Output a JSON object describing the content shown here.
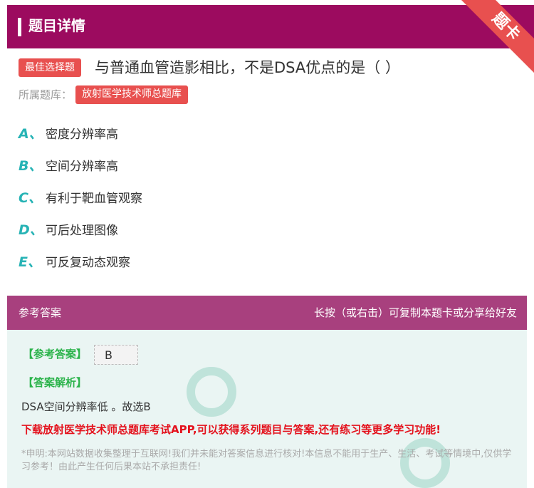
{
  "header": {
    "title": "题目详情",
    "corner_badge": "题卡"
  },
  "question": {
    "type_tag": "最佳选择题",
    "text": "与普通血管造影相比，不是DSA优点的是（ ）",
    "library_label": "所属题库：",
    "library_name": "放射医学技术师总题库"
  },
  "options": [
    {
      "letter": "A、",
      "text": "密度分辨率高"
    },
    {
      "letter": "B、",
      "text": "空间分辨率高"
    },
    {
      "letter": "C、",
      "text": "有利于靶血管观察"
    },
    {
      "letter": "D、",
      "text": "可后处理图像"
    },
    {
      "letter": "E、",
      "text": "可反复动态观察"
    }
  ],
  "answer_section": {
    "title": "参考答案",
    "hint": "长按（或右击）可复制本题卡或分享给好友",
    "answer_label": "【参考答案】",
    "answer_value": "B",
    "explanation_label": "【答案解析】",
    "explanation": "DSA空间分辨率低 。故选B",
    "promo": "下载放射医学技术师总题库考试APP,可以获得系列题目与答案,还有练习等更多学习功能!",
    "disclaimer": "*申明:本网站数据收集整理于互联网!我们并未能对答案信息进行核对!本信息不能用于生产、生活、考试等情境中,仅供学习参考！由此产生任何后果本站不承担责任!"
  },
  "colors": {
    "header_bg": "#9c0b5f",
    "accent_red": "#e8504f",
    "option_letter": "#27b3b5",
    "answer_green": "#2bb34b",
    "promo_red": "#e4121d"
  }
}
